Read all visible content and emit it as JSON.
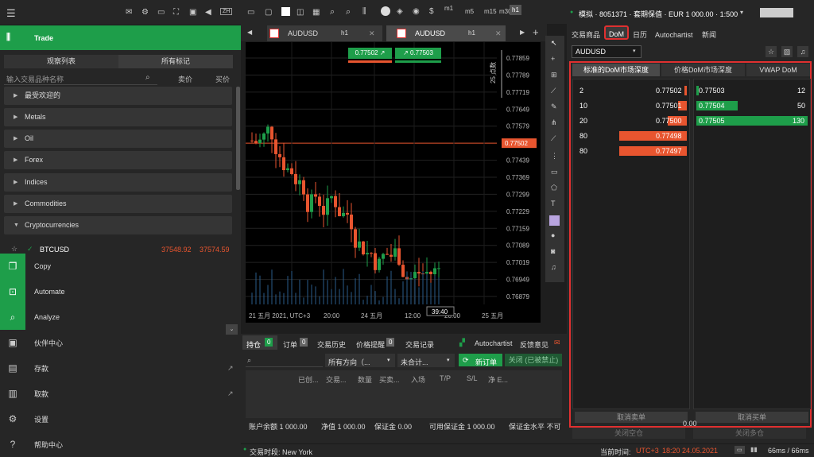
{
  "left": {
    "trade": "Trade",
    "tabs": [
      "观察列表",
      "所有标记"
    ],
    "search_placeholder": "输入交易品种名称",
    "col_sell": "卖价",
    "col_buy": "买价",
    "categories": [
      "最受欢迎的",
      "Metals",
      "Oil",
      "Forex",
      "Indices",
      "Commodities",
      "Cryptocurrencies"
    ],
    "btc": {
      "name": "BTCUSD",
      "bid": "37548.92",
      "ask": "37574.59"
    },
    "side": [
      "Copy",
      "Automate",
      "Analyze"
    ],
    "menu": [
      "伙伴中心",
      "存款",
      "取款",
      "设置",
      "帮助中心"
    ],
    "top_badge": "ZH"
  },
  "toolbar": {
    "periods": [
      "m1",
      "m5",
      "m15",
      "m30",
      "h1"
    ]
  },
  "chart_tabs": [
    {
      "sym": "AUDUSD",
      "tf": "h1"
    },
    {
      "sym": "AUDUSD",
      "tf": "h1"
    }
  ],
  "chart": {
    "sell": "0.77502",
    "buy": "0.77503",
    "prices": [
      "0.77859",
      "0.77789",
      "0.77719",
      "0.77649",
      "0.77579",
      "0.77502",
      "0.77439",
      "0.77369",
      "0.77299",
      "0.77229",
      "0.77159",
      "0.77089",
      "0.77019",
      "0.76949",
      "0.76879"
    ],
    "x_labels": [
      "21 五月 2021, UTC+3",
      "20:00",
      "24 五月",
      "12:00",
      "20:00",
      "25 五月"
    ],
    "countdown": "39:40",
    "pips": "25 点数"
  },
  "bottom": {
    "tabs": [
      "持仓",
      "订单",
      "交易历史",
      "价格提醒",
      "交易记录"
    ],
    "counts": [
      "0",
      "0",
      "0"
    ],
    "autochartist": "Autochartist",
    "feedback": "反馈意见",
    "dir": "所有方向（...",
    "pnl": "未合计...",
    "new_order": "新订单",
    "close_all": "关闭 (已被禁止)",
    "cols": [
      "已创...",
      "交易...",
      "数量",
      "买卖...",
      "入场",
      "T/P",
      "S/L",
      "净 E..."
    ],
    "balance": "账户余额 1 000.00",
    "equity": "净值 1 000.00",
    "margin": "保证金 0.00",
    "free": "可用保证金 1 000.00",
    "level": "保证金水平 不可"
  },
  "right": {
    "account": "模拟 · 8051371 · 套期保值 · EUR 1 000.00 · 1:500",
    "tabs": [
      "交易商品",
      "DoM",
      "日历",
      "Autochartist",
      "新闻"
    ],
    "symbol": "AUDUSD",
    "dom_tabs": [
      "标准的DoM市场深度",
      "价格DoM市场深度",
      "VWAP DoM"
    ],
    "bids": [
      {
        "v": "2",
        "p": "0.77502"
      },
      {
        "v": "10",
        "p": "0.77501"
      },
      {
        "v": "20",
        "p": "0.77500"
      },
      {
        "v": "80",
        "p": "0.77498"
      },
      {
        "v": "80",
        "p": "0.77497"
      }
    ],
    "asks": [
      {
        "p": "0.77503",
        "v": "12"
      },
      {
        "p": "0.77504",
        "v": "50"
      },
      {
        "p": "0.77505",
        "v": "130"
      }
    ],
    "cancel_sell": "取消卖单",
    "cancel_buy": "取消买单",
    "mid": "0.00",
    "close_short": "关闭空仓",
    "close_long": "关闭多仓"
  },
  "status": {
    "session": "交易时段: New York",
    "time_label": "当前时间:",
    "tz": "UTC+3",
    "time": "18:20 24.05.2021",
    "latency": "66ms / 66ms"
  },
  "colors": {
    "green": "#1e9e4a",
    "red": "#e8552f",
    "dom_border": "#e03030"
  }
}
